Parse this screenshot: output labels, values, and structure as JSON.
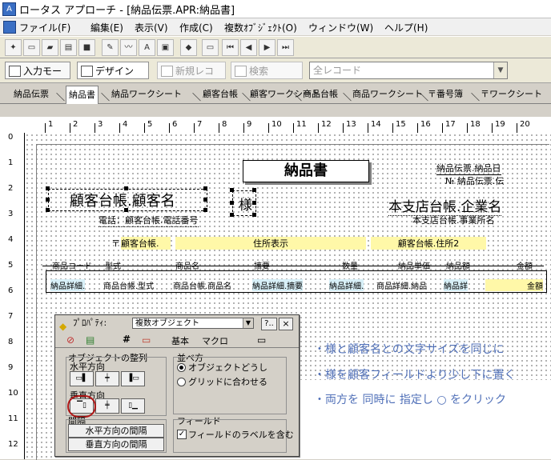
{
  "window": {
    "title": "ロータス アプローチ - [納品伝票.APR:納品書]"
  },
  "menu": [
    "ファイル(F)",
    "編集(E)",
    "表示(V)",
    "作成(C)",
    "複数ｵﾌﾞｼﾞｪｸﾄ(O)",
    "ウィンドウ(W)",
    "ヘルプ(H)"
  ],
  "toolbar2": {
    "input_mode": "入力モード",
    "design": "デザイン",
    "new_record": "新規レコード",
    "search": "検索",
    "all_records": "全レコード"
  },
  "view_tabs": [
    "納品伝票",
    "納品書",
    "納品ワークシート",
    "顧客台帳",
    "顧客ワークシート",
    "商品台帳",
    "商品ワークシート",
    "〒番号簿",
    "〒ワークシート"
  ],
  "ruler": {
    "h": [
      "1",
      "2",
      "3",
      "4",
      "5",
      "6",
      "7",
      "8",
      "9",
      "10",
      "11",
      "12",
      "13",
      "14",
      "15",
      "16",
      "17",
      "18",
      "19",
      "20"
    ],
    "v": [
      "0",
      "1",
      "2",
      "3",
      "4",
      "5",
      "6",
      "7",
      "8",
      "9",
      "10",
      "11",
      "12"
    ]
  },
  "form": {
    "title": "納品書",
    "date_field": "納品伝票.納品日",
    "no_field": "№ 納品伝票.伝",
    "customer_name": "顧客台帳.顧客名",
    "sama": "様",
    "phone": "電話：顧客台帳.電話番号",
    "company_name": "本支店台帳.企業名",
    "branch_name": "本支店台帳.事業所名",
    "postal_mark": "〒",
    "postal_code": "顧客台帳.",
    "address_display": "住所表示",
    "address2": "顧客台帳.住所2",
    "col_headers": [
      "商品コード",
      "型式",
      "商品名",
      "摘要",
      "数量",
      "納品単価",
      "納品額",
      "金額"
    ],
    "detail_fields": [
      "納品詳細.",
      "商品台帳.型式",
      "商品台帳.商品名",
      "納品詳細.摘要",
      "納品詳細.",
      "商品詳細.納品",
      "納品詳",
      "金額"
    ]
  },
  "dialog": {
    "title": "ﾌﾟﾛﾊﾟﾃｨ:",
    "object_select": "複数オブジェクト",
    "help_btn": "?..",
    "close_btn": "×",
    "tabs": [
      "基本",
      "マクロ"
    ],
    "align_group": "オブジェクトの整列",
    "horizontal": "水平方向",
    "vertical": "垂直方向",
    "spacing": "間隔",
    "arrange_group": "並べ方",
    "radio1": "オブジェクトどうし",
    "radio2": "グリッドに合わせる",
    "field_group": "フィールド",
    "include_label": "フィールドのラベルを含む",
    "btn_h_spacing": "水平方向の間隔",
    "btn_v_spacing": "垂直方向の間隔"
  },
  "annotations": [
    "・様と顧客名との文字サイズを同じに",
    "・様を顧客フィールドより少し下に置く",
    "・両方を 同時に 指定し ○ をクリック"
  ]
}
